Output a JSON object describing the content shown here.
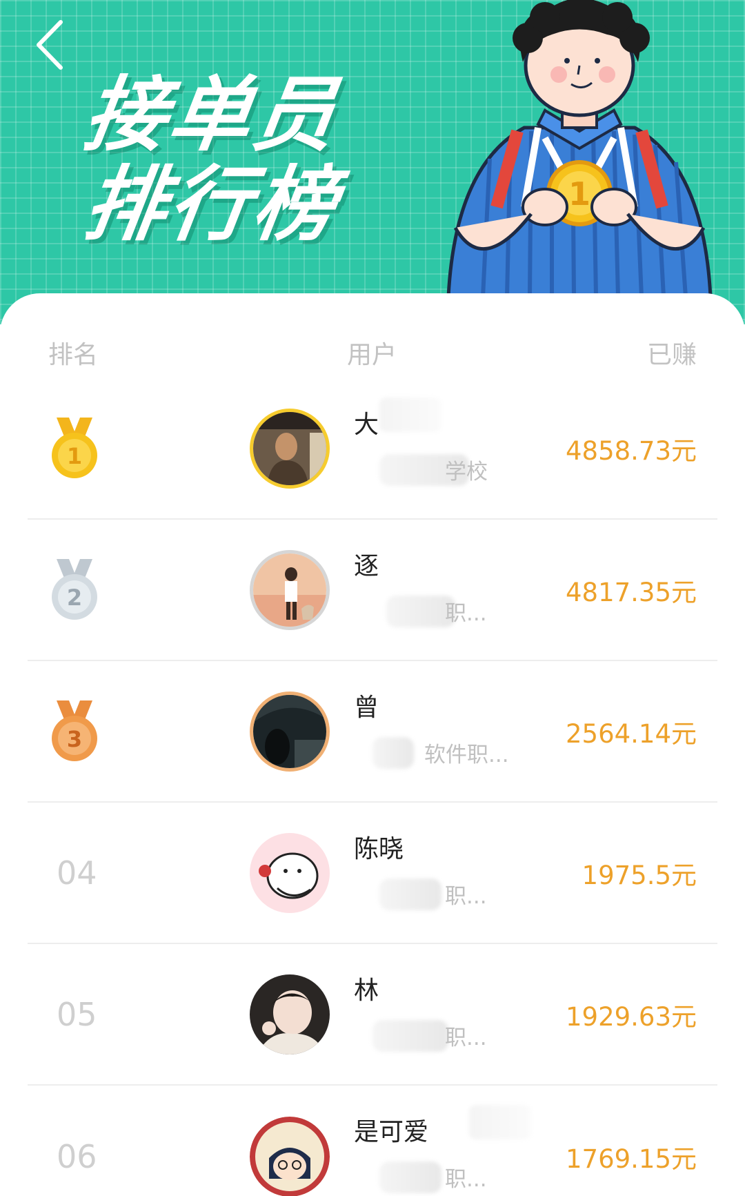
{
  "header": {
    "title_line1": "接单员",
    "title_line2": "排行榜"
  },
  "columns": {
    "rank": "排名",
    "user": "用户",
    "earned": "已赚"
  },
  "rows": [
    {
      "rank": "1",
      "medal": "gold-medal",
      "name": "大",
      "info": "学校",
      "amount": "4858.73元"
    },
    {
      "rank": "2",
      "medal": "silver-medal",
      "name": "逐",
      "info": "职...",
      "amount": "4817.35元"
    },
    {
      "rank": "3",
      "medal": "bronze-medal",
      "name": "曾",
      "info": "软件职...",
      "amount": "2564.14元"
    },
    {
      "rank": "04",
      "name": "陈晓",
      "info": "职...",
      "amount": "1975.5元"
    },
    {
      "rank": "05",
      "name": "林",
      "info": "职...",
      "amount": "1929.63元"
    },
    {
      "rank": "06",
      "name": "是可爱",
      "info": "职...",
      "amount": "1769.15元"
    }
  ],
  "colors": {
    "header_bg": "#2ec7a6",
    "amount": "#eda12a",
    "gold": "#f6c21c",
    "silver": "#cfd6dc",
    "bronze": "#f09a4a"
  }
}
